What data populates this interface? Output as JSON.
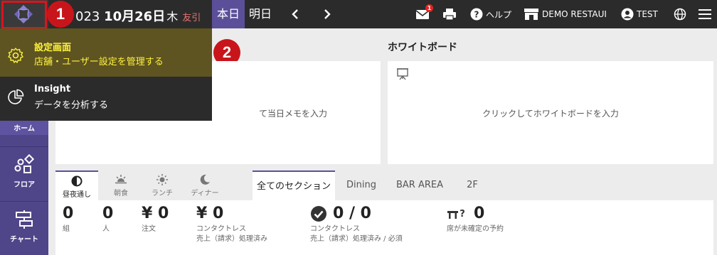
{
  "topbar": {
    "date_year": "023",
    "date_md": "10月26日",
    "weekday": "木",
    "rokuyo": "友引",
    "today_label": "本日",
    "tomorrow_label": "明日",
    "mail_badge": "1",
    "help_label": "ヘルプ",
    "restaurant_label": "DEMO RESTAUI",
    "user_label": "TEST"
  },
  "markers": {
    "one": "1",
    "two": "2"
  },
  "menu": {
    "settings_title": "設定画面",
    "settings_sub": "店舗・ユーザー設定を管理する",
    "insight_title": "Insight",
    "insight_sub": "データを分析する"
  },
  "sidebar": {
    "home_label": "ホーム",
    "floor_label": "フロア",
    "chart_label": "チャート"
  },
  "panels": {
    "whiteboard_title": "ホワイトボード",
    "memo_placeholder": "て当日メモを入力",
    "whiteboard_placeholder": "クリックしてホワイトボードを入力"
  },
  "mode_tabs": [
    "昼夜通し",
    "朝食",
    "ランチ",
    "ディナー"
  ],
  "section_tabs": [
    "全てのセクション",
    "Dining",
    "BAR AREA",
    "2F"
  ],
  "stats": [
    {
      "value": "0",
      "label": "組"
    },
    {
      "value": "0",
      "label": "人"
    },
    {
      "value": "¥ 0",
      "label": "注文"
    },
    {
      "value": "¥ 0",
      "label": "コンタクトレス",
      "label2": "売上（請求）処理済み"
    },
    {
      "value": "0 / 0",
      "label": "コンタクトレス",
      "label2": "売上（請求）処理済み / 必須"
    },
    {
      "value": "0",
      "label": "席が未確定の予約"
    }
  ],
  "colors": {
    "topbar": "#2b2b2b",
    "accent_purple": "#5c4f9a",
    "sidebar": "#4f4589",
    "marker_red": "#c8151b",
    "settings_highlight_bg": "#5e5422",
    "settings_highlight_text": "#fff33a"
  }
}
